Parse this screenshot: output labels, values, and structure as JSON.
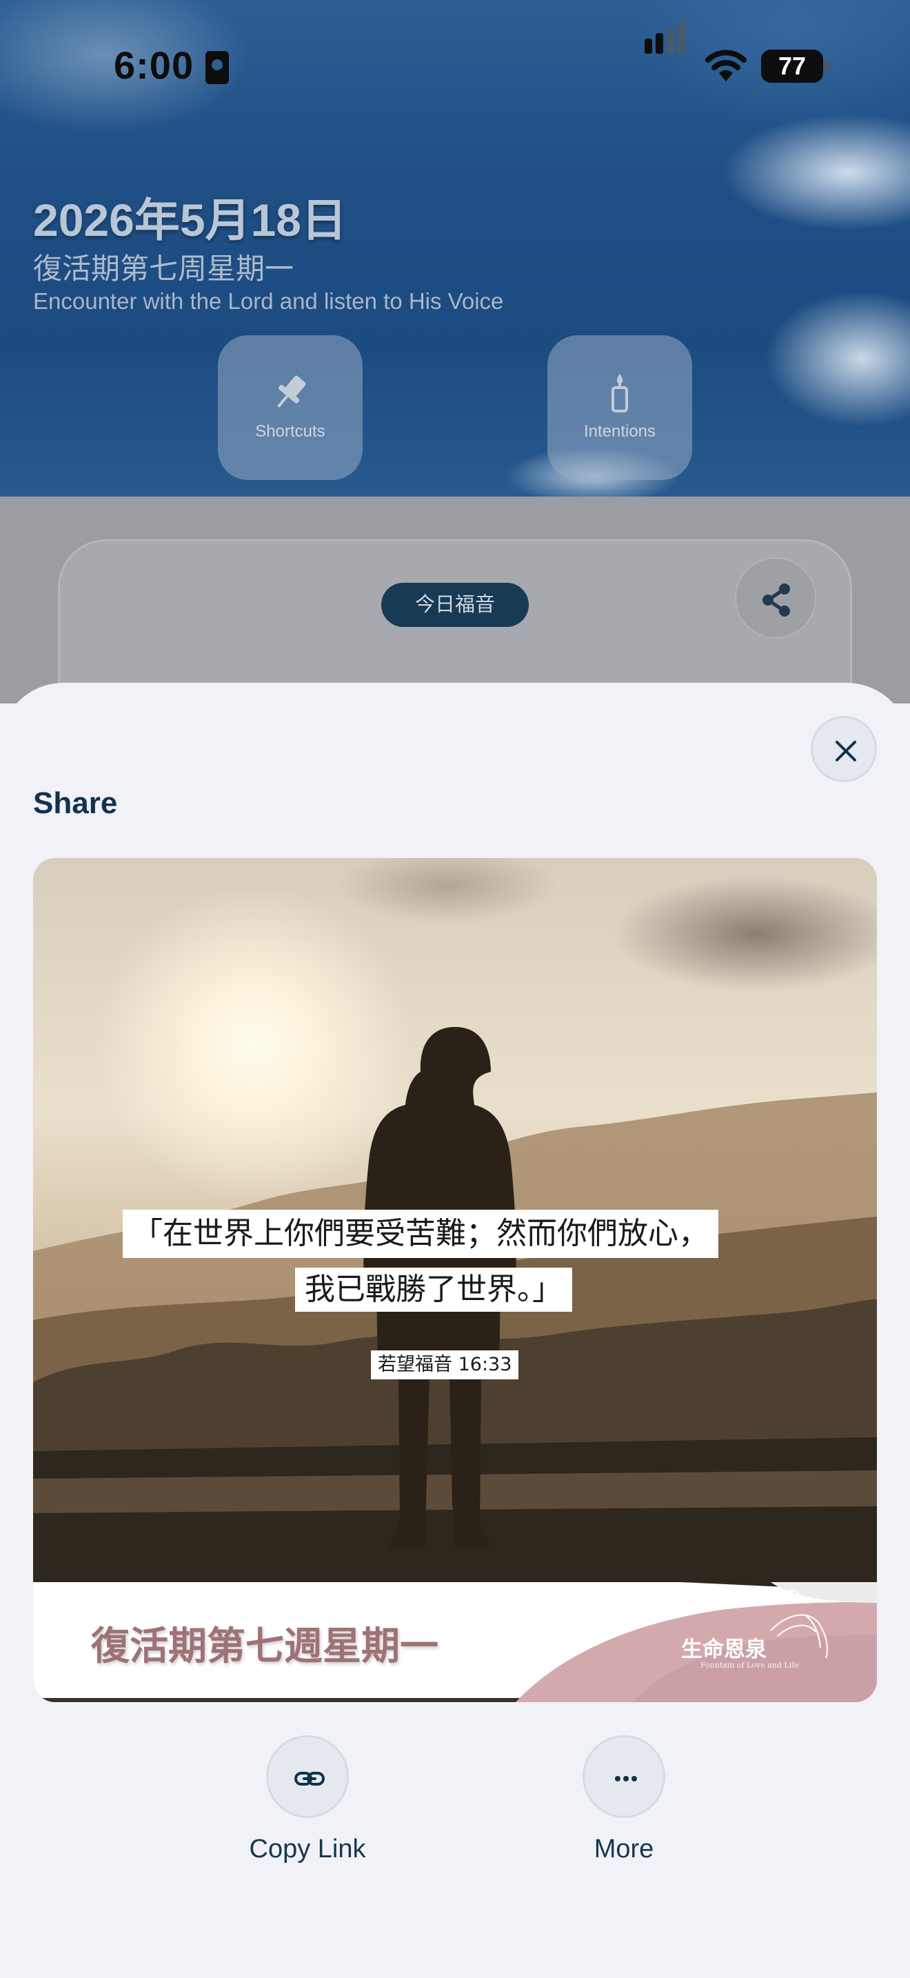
{
  "status_bar": {
    "time": "6:00",
    "battery": "77"
  },
  "hero": {
    "date": "2026年5月18日",
    "liturgical_day": "復活期第七周星期一",
    "tagline": "Encounter with the Lord and listen to His Voice",
    "buttons": [
      {
        "label": "Shortcuts",
        "icon": "pin-icon"
      },
      {
        "label": "Intentions",
        "icon": "candle-icon"
      }
    ]
  },
  "card": {
    "gospel_label": "今日福音"
  },
  "share_sheet": {
    "title": "Share",
    "preview": {
      "quote_line1": "「在世界上你們要受苦難；然而你們放心，",
      "quote_line2": "我已戰勝了世界。」",
      "reference": "若望福音 16:33",
      "footer_title": "復活期第七週星期一",
      "logo_text": "生命恩泉",
      "logo_subtext": "Fountain of Love and Life",
      "footer_color": "#d4a9ae"
    },
    "actions": [
      {
        "label": "Copy Link",
        "icon": "link-icon"
      },
      {
        "label": "More",
        "icon": "ellipsis-icon"
      }
    ]
  },
  "colors": {
    "accent": "#11324d",
    "pill": "#173a55",
    "sheet_bg": "#f1f2f7"
  }
}
